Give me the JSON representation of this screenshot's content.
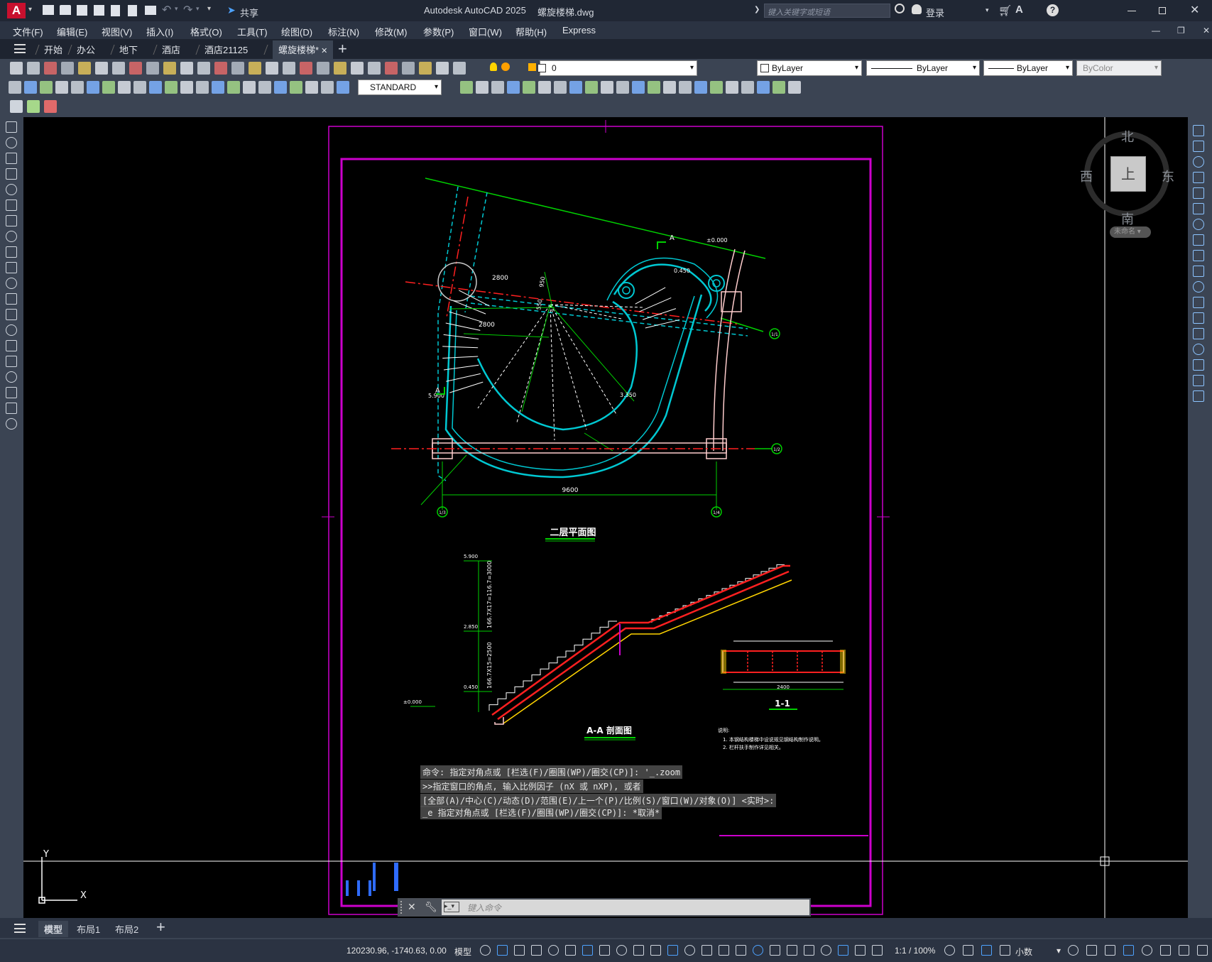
{
  "app": {
    "title": "Autodesk AutoCAD 2025",
    "file": "螺旋楼梯.dwg",
    "search_placeholder": "键入关键字或短语",
    "login": "登录",
    "share": "共享"
  },
  "menu": [
    "文件(F)",
    "编辑(E)",
    "视图(V)",
    "插入(I)",
    "格式(O)",
    "工具(T)",
    "绘图(D)",
    "标注(N)",
    "修改(M)",
    "参数(P)",
    "窗口(W)",
    "帮助(H)",
    "Express"
  ],
  "tabs": [
    {
      "label": "开始"
    },
    {
      "label": "办公"
    },
    {
      "label": "地下"
    },
    {
      "label": "酒店"
    },
    {
      "label": "酒店21125"
    },
    {
      "label": "螺旋楼梯*",
      "active": true
    }
  ],
  "toolbar": {
    "layer": "0",
    "color": "ByLayer",
    "linetype": "ByLayer",
    "lineweight": "ByLayer",
    "plotstyle": "ByColor",
    "textstyle": "STANDARD"
  },
  "compass": {
    "n": "北",
    "s": "南",
    "e": "东",
    "w": "西",
    "top": "上",
    "ucs": "未命名"
  },
  "drawing": {
    "plan_title": "二层平面图",
    "section_title": "A-A 剖面图",
    "detail_title": "1-1",
    "dims": {
      "d9600": "9600",
      "d2800a": "2800",
      "d2800b": "2800",
      "d950": "950",
      "d550": "550",
      "e0000": "±0.000",
      "e0450": "0.450",
      "e5900": "5.900",
      "e3350": "3.350",
      "e3000": "5.900",
      "h1": "166.7X17=116.7=3000",
      "h2": "166.7X15=2500",
      "e2850": "2.850",
      "e0450b": "0.450",
      "e0000b": "±0.000",
      "w2400": "2400"
    },
    "axes": {
      "a1": "1/1",
      "a2": "1/2",
      "a3": "1/3",
      "a4": "1/4"
    },
    "notes_title": "说明:",
    "notes": [
      "1. 本钢结构楼梯中设说规见钢结构制作说明。",
      "2. 栏杆扶手制作详见相关。"
    ],
    "section_mark": "A"
  },
  "command": {
    "lines": [
      "命令: 指定对角点或 [栏选(F)/圈围(WP)/圈交(CP)]: '_.zoom",
      ">>指定窗口的角点, 输入比例因子 (nX 或 nXP), 或者",
      "[全部(A)/中心(C)/动态(D)/范围(E)/上一个(P)/比例(S)/窗口(W)/对象(O)] <实时>:",
      "_e 指定对角点或 [栏选(F)/圈围(WP)/圈交(CP)]: *取消*"
    ],
    "placeholder": "键入命令"
  },
  "layouts": [
    {
      "label": "模型",
      "active": true
    },
    {
      "label": "布局1"
    },
    {
      "label": "布局2"
    }
  ],
  "status": {
    "coords": "120230.96, -1740.63, 0.00",
    "model": "模型",
    "scale": "1:1 / 100%",
    "units": "小数"
  },
  "colors": {
    "magenta": "#cc00cc",
    "cyan": "#00c8d2",
    "green": "#00d000",
    "red": "#ff2020",
    "yellow": "#ffd400"
  }
}
